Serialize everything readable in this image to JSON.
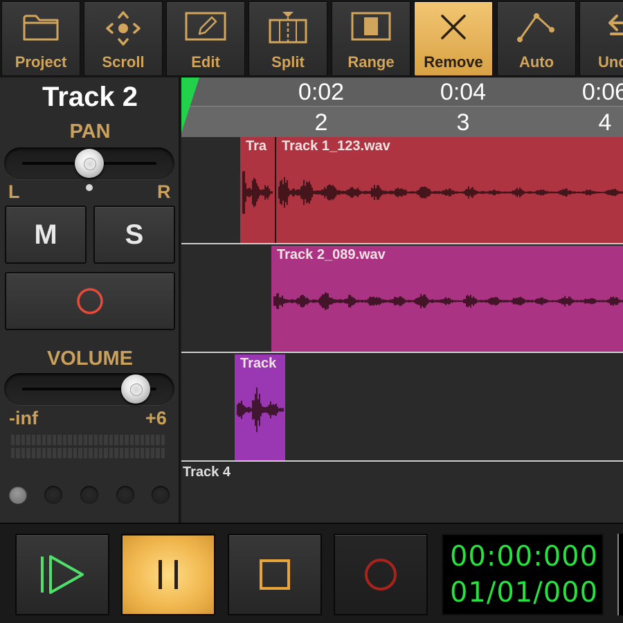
{
  "toolbar": {
    "buttons": [
      {
        "label": "Project",
        "icon": "folder-icon"
      },
      {
        "label": "Scroll",
        "icon": "move-arrows-icon"
      },
      {
        "label": "Edit",
        "icon": "edit-pencil-icon"
      },
      {
        "label": "Split",
        "icon": "split-icon"
      },
      {
        "label": "Range",
        "icon": "range-icon"
      },
      {
        "label": "Remove",
        "icon": "close-x-icon",
        "active": true
      },
      {
        "label": "Auto",
        "icon": "automation-icon"
      },
      {
        "label": "Und",
        "icon": "undo-icon"
      }
    ]
  },
  "track_panel": {
    "track_name": "Track 2",
    "pan": {
      "label": "PAN",
      "left": "L",
      "right": "R",
      "value_fraction": 0.5
    },
    "mute_label": "M",
    "solo_label": "S",
    "record_arm_icon": "record-circle-icon",
    "volume": {
      "label": "VOLUME",
      "min": "-inf",
      "max": "+6",
      "value_fraction": 0.85
    },
    "meter_segments": 30,
    "leds": [
      true,
      false,
      false,
      false,
      false
    ]
  },
  "timeline": {
    "time_labels": [
      "0:02",
      "0:04",
      "0:06"
    ],
    "bar_labels": [
      "2",
      "3",
      "4"
    ],
    "tracks": [
      {
        "label": "",
        "clips": [
          {
            "title": "Tra",
            "color": "#ad3440"
          },
          {
            "title": "Track 1_123.wav",
            "color": "#ad3440"
          }
        ]
      },
      {
        "label": "",
        "clips": [
          {
            "title": "Track 2_089.wav",
            "color": "#ab3384"
          }
        ]
      },
      {
        "label": "",
        "clips": [
          {
            "title": "Track",
            "color": "#9a38b4"
          }
        ]
      },
      {
        "label": "Track 4",
        "clips": []
      }
    ]
  },
  "transport": {
    "buttons": [
      {
        "name": "play",
        "icon": "play-icon"
      },
      {
        "name": "pause",
        "icon": "pause-icon",
        "active": true
      },
      {
        "name": "stop",
        "icon": "stop-icon"
      },
      {
        "name": "record",
        "icon": "record-icon"
      }
    ],
    "time": "00:00:000",
    "bars": "01/01/000"
  },
  "colors": {
    "accent_gold": "#d2a55c",
    "active_button": "#f0b64e",
    "lcd_green": "#28e040",
    "record_red": "#e84a3a"
  }
}
